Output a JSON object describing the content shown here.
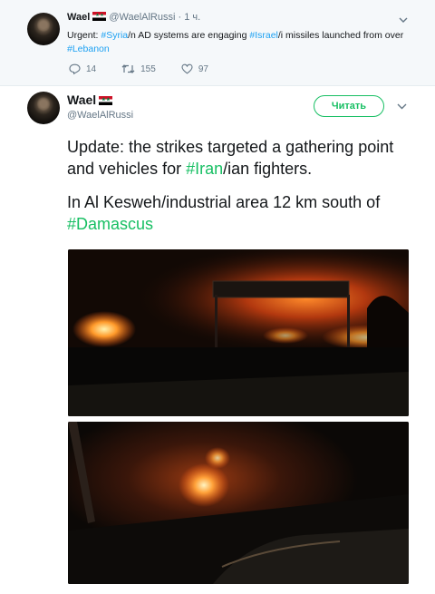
{
  "reply": {
    "name": "Wael",
    "handle": "@WaelAlRussi",
    "separator": "·",
    "time": "1 ч.",
    "text_parts": {
      "p1": "Urgent: ",
      "tag1": "#Syria",
      "p2": "/n AD systems are engaging ",
      "tag2": "#Israel",
      "p3": "/i missiles launched from over ",
      "tag3": "#Lebanon"
    },
    "counts": {
      "replies": "14",
      "retweets": "155",
      "likes": "97"
    },
    "icons": [
      "reply-icon",
      "retweet-icon",
      "heart-icon",
      "chevron-down-icon"
    ]
  },
  "tweet": {
    "name": "Wael",
    "handle": "@WaelAlRussi",
    "follow_label": "Читать",
    "text_parts": {
      "p1a": "Update: the strikes targeted a gathering point and vehicles for ",
      "tag1": "#Iran",
      "p1b": "/ian fighters.",
      "p2a": "In Al Kesweh/industrial area 12 km south of ",
      "tag2": "#Damascus"
    },
    "media": [
      "night-fire-photo",
      "burning-vehicle-photo"
    ]
  },
  "colors": {
    "link": "#1da1f2",
    "accent_green": "#17bf63",
    "muted": "#657786",
    "bg_reply": "#f5f8fa"
  }
}
